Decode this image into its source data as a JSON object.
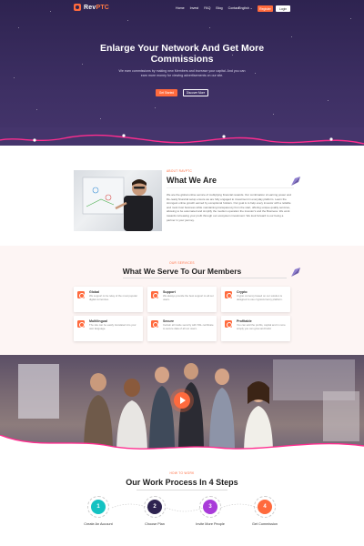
{
  "brand": {
    "name_a": "Rev",
    "name_b": "PTC",
    "accent": "#ff6a3d",
    "dark": "#2e2350"
  },
  "nav": {
    "links": [
      "Home",
      "Invest",
      "FAQ",
      "Blog",
      "Contact"
    ],
    "language": "English ⌄",
    "register_label": "Register",
    "login_label": "Login"
  },
  "hero": {
    "title": "Enlarge Your Network And Get More Commissions",
    "subtitle": "We earn commissions by making new Members and increase your capital. And you can earn more money for viewing advertisements on our site.",
    "btn_primary": "Get Started",
    "btn_secondary": "Discover More"
  },
  "about": {
    "tag": "ABOUT RAVPTC",
    "title": "What We Are",
    "text": "We are the global online service of multiplying financial rewards. Our combination of earning power and life-ready financial setup ensure we are fully engaged to investment in everyday platform. Learn the strongest online growth earned by exceptional holders. Our goal is to help every investor with a reliable and most trust business while maintaining transparency from the start, offering unique quality services, allowing to be automated and simplify the medium operation the investor's and the Business. We work towards increasing your profit through our ecosystem investment. We look forward to our being a partner in your journey."
  },
  "serve": {
    "tag": "OUR SERVICES",
    "title": "What We Serve To Our Members",
    "cards": [
      {
        "title": "Global",
        "desc": "We support to be relay of the most popular digital currencies."
      },
      {
        "title": "Support",
        "desc": "We always provide the best support to all our users."
      },
      {
        "title": "Crypto",
        "desc": "Crypto currency based on our solution is designed to use cryptocurrency platform."
      },
      {
        "title": "Multilingual",
        "desc": "The site can be easily translated into your own language."
      },
      {
        "title": "Secure",
        "desc": "Certain all inside security with SSL certificate to secure data of all our users."
      },
      {
        "title": "Profitable",
        "desc": "You can add the profits, capital and in more simply you can grow and build."
      }
    ]
  },
  "steps": {
    "tag": "HOW TO WORK",
    "title": "Our Work Process In 4 Steps",
    "items": [
      {
        "num": "1",
        "label": "Create An Account",
        "color": "#14c2c2"
      },
      {
        "num": "2",
        "label": "Choose Plan",
        "color": "#2e2350"
      },
      {
        "num": "3",
        "label": "Invite More People",
        "color": "#a93bd9"
      },
      {
        "num": "4",
        "label": "Get Commission",
        "color": "#ff6a3d"
      }
    ]
  }
}
